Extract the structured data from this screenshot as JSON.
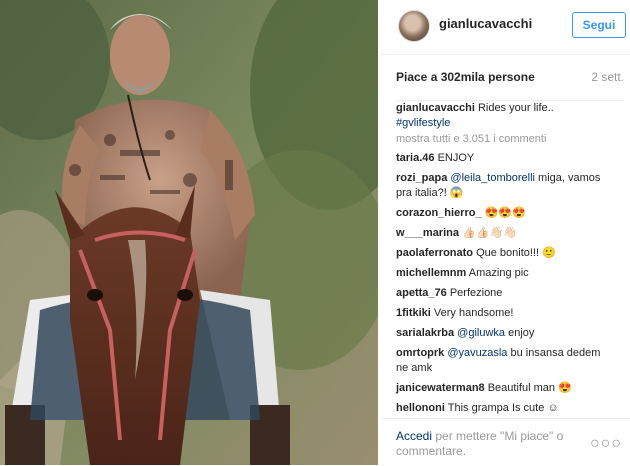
{
  "post": {
    "username": "gianlucavacchi",
    "follow_label": "Segui",
    "likes_text": "Piace a 302mila persone",
    "time_text": "2 sett.",
    "caption": {
      "user": "gianlucavacchi",
      "text": "Rides your life..",
      "hashtag": "#gvlifestyle"
    },
    "show_all_text": "mostra tutti e 3.051 i commenti",
    "comments": [
      {
        "user": "taria.46",
        "text": "ENJOY"
      },
      {
        "user": "rozi_papa",
        "mention": "@leila_tomborelli",
        "text": " miga, vamos"
      },
      {
        "user": "",
        "text": "pra italia?! 😱"
      },
      {
        "user": "corazon_hierro_",
        "text": "😍😍😍"
      },
      {
        "user": "w___marina",
        "text": "👍🏻👍🏻👋🏻👋🏻"
      },
      {
        "user": "paolaferronato",
        "text": "Que bonito!!! 🙂"
      },
      {
        "user": "michellemnm",
        "text": "Amazing pic"
      },
      {
        "user": "apetta_76",
        "text": "Perfezione"
      },
      {
        "user": "1fitkiki",
        "text": "Very handsome!"
      },
      {
        "user": "sarialakrba",
        "mention": "@giluwka",
        "text": " enjoy"
      },
      {
        "user": "omrtoprk",
        "mention": "@yavuzasla",
        "text": " bu insansa dedem"
      },
      {
        "user": "",
        "text": "ne amk"
      },
      {
        "user": "janicewaterman8",
        "text": "Beautiful man 😍"
      },
      {
        "user": "hellononi",
        "text": "This grampa Is cute ☺"
      }
    ],
    "footer": {
      "login_link": "Accedi",
      "rest": " per mettere \"Mi piace\" o commentare.",
      "more_icon": "ellipsis-icon",
      "more_glyph": "○○○"
    }
  }
}
